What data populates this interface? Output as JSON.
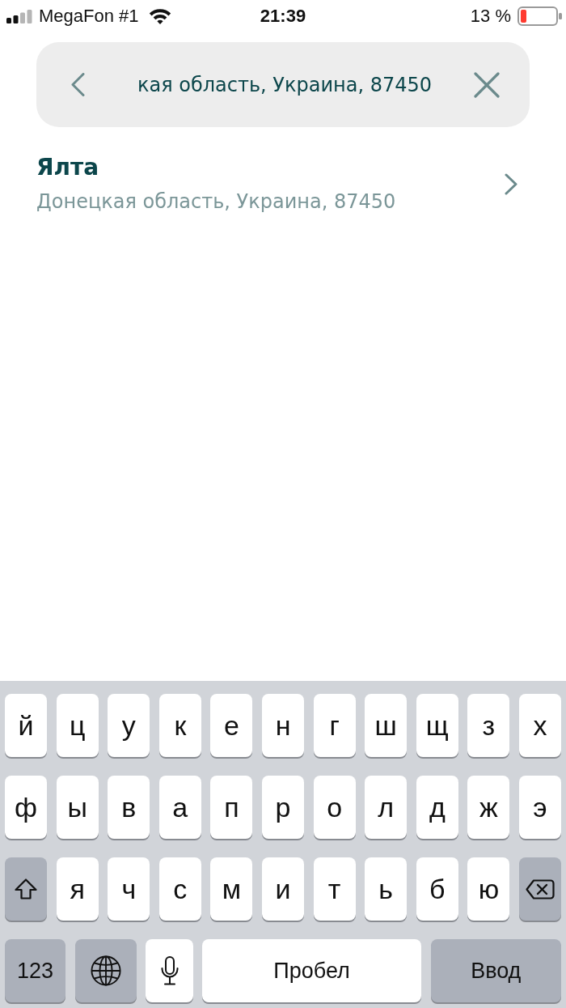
{
  "status_bar": {
    "carrier": "MegaFon #1",
    "time": "21:39",
    "battery_percent": "13 %"
  },
  "search": {
    "value": "кая область, Украина, 87450"
  },
  "results": [
    {
      "title": "Ялта",
      "subtitle": "Донецкая область, Украина, 87450"
    }
  ],
  "keyboard": {
    "key_rows": [
      {
        "keys": [
          {
            "kind": "letter",
            "label": "й"
          },
          {
            "kind": "letter",
            "label": "ц"
          },
          {
            "kind": "letter",
            "label": "у"
          },
          {
            "kind": "letter",
            "label": "к"
          },
          {
            "kind": "letter",
            "label": "е"
          },
          {
            "kind": "letter",
            "label": "н"
          },
          {
            "kind": "letter",
            "label": "г"
          },
          {
            "kind": "letter",
            "label": "ш"
          },
          {
            "kind": "letter",
            "label": "щ"
          },
          {
            "kind": "letter",
            "label": "з"
          },
          {
            "kind": "letter",
            "label": "х"
          }
        ]
      },
      {
        "keys": [
          {
            "kind": "letter",
            "label": "ф"
          },
          {
            "kind": "letter",
            "label": "ы"
          },
          {
            "kind": "letter",
            "label": "в"
          },
          {
            "kind": "letter",
            "label": "а"
          },
          {
            "kind": "letter",
            "label": "п"
          },
          {
            "kind": "letter",
            "label": "р"
          },
          {
            "kind": "letter",
            "label": "о"
          },
          {
            "kind": "letter",
            "label": "л"
          },
          {
            "kind": "letter",
            "label": "д"
          },
          {
            "kind": "letter",
            "label": "ж"
          },
          {
            "kind": "letter",
            "label": "э"
          }
        ]
      },
      {
        "keys": [
          {
            "kind": "shift"
          },
          {
            "kind": "letter",
            "label": "я"
          },
          {
            "kind": "letter",
            "label": "ч"
          },
          {
            "kind": "letter",
            "label": "с"
          },
          {
            "kind": "letter",
            "label": "м"
          },
          {
            "kind": "letter",
            "label": "и"
          },
          {
            "kind": "letter",
            "label": "т"
          },
          {
            "kind": "letter",
            "label": "ь"
          },
          {
            "kind": "letter",
            "label": "б"
          },
          {
            "kind": "letter",
            "label": "ю"
          },
          {
            "kind": "backspace"
          }
        ]
      },
      {
        "keys": [
          {
            "kind": "mode",
            "label": "123"
          },
          {
            "kind": "globe"
          },
          {
            "kind": "dictation"
          },
          {
            "kind": "space",
            "label": "Пробел"
          },
          {
            "kind": "return",
            "label": "Ввод"
          }
        ]
      }
    ]
  }
}
